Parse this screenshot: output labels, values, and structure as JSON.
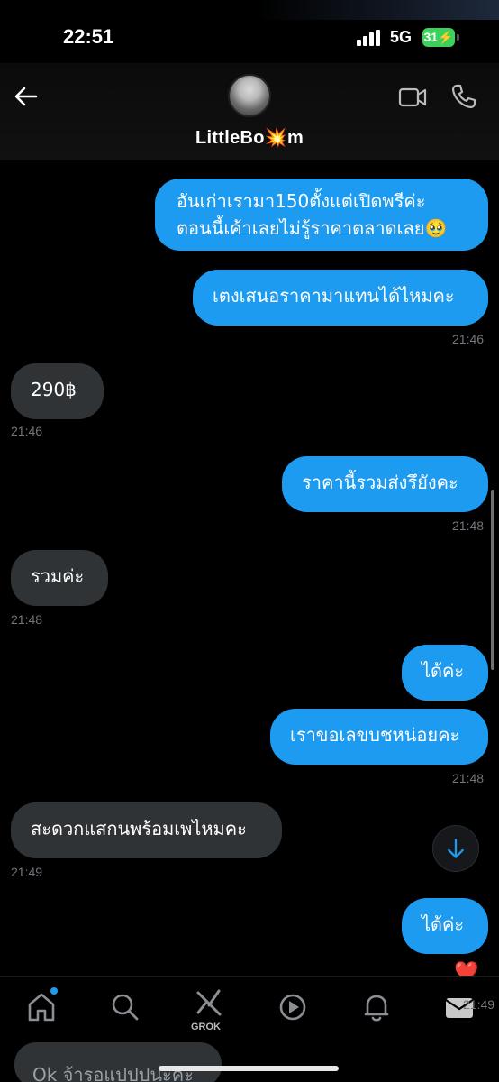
{
  "status_bar": {
    "time": "22:51",
    "network": "5G",
    "battery": "31"
  },
  "header": {
    "name": "LittleBo💥m",
    "icons": [
      "back-arrow-icon",
      "video-call-icon",
      "phone-icon"
    ]
  },
  "messages": [
    {
      "dir": "out",
      "lines": [
        "อันเก่าเรามา150ตั้งแต่เปิดพรีค่ะ",
        "ตอนนี้เค้าเลยไม่รู้ราคาตลาดเลย🥹"
      ]
    },
    {
      "dir": "out",
      "text": "เตงเสนอราคามาแทนได้ไหมคะ",
      "time": "21:46"
    },
    {
      "dir": "in",
      "text": "290฿",
      "time": "21:46"
    },
    {
      "dir": "out",
      "text": "ราคานี้รวมส่งรึยังคะ",
      "time": "21:48"
    },
    {
      "dir": "in",
      "text": "รวมค่ะ",
      "time": "21:48"
    },
    {
      "dir": "out",
      "text": "ได้ค่ะ"
    },
    {
      "dir": "out",
      "text": "เราขอเลขบชหน่อยคะ",
      "time": "21:48"
    },
    {
      "dir": "in",
      "text": "สะดวกแสกนพร้อมเพไหมคะ",
      "time": "21:49"
    },
    {
      "dir": "out",
      "text": "ได้ค่ะ",
      "time": "21:49",
      "reaction": "❤️"
    }
  ],
  "nav": {
    "items": [
      "home-icon",
      "search-icon",
      "grok-icon",
      "video-icon",
      "notifications-icon",
      "messages-icon"
    ],
    "grok_label": "GROK"
  },
  "composer": {
    "draft": "Ok จ้ารอแปปปนะคะ"
  },
  "colors": {
    "accent": "#1d9bf0",
    "incoming": "#2f3336",
    "background": "#000000"
  }
}
